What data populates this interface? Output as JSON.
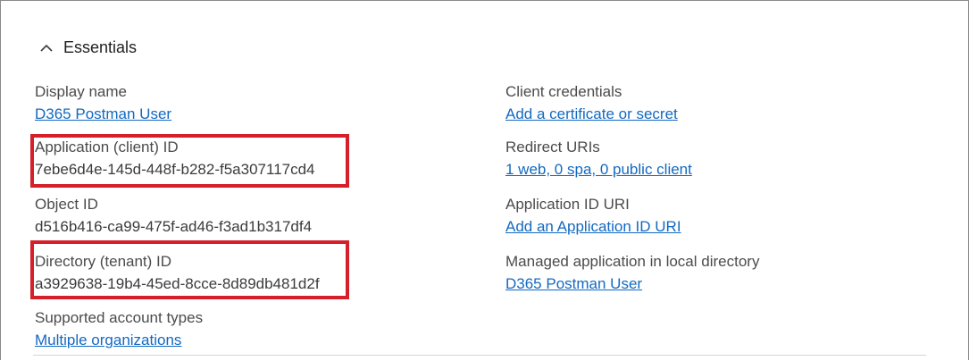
{
  "essentials": {
    "title": "Essentials",
    "chevron_icon": "chevron-up-icon"
  },
  "left_column": [
    {
      "label": "Display name",
      "value": "D365 Postman User",
      "is_link": true
    },
    {
      "label": "Application (client) ID",
      "value": "7ebe6d4e-145d-448f-b282-f5a307117cd4",
      "is_link": false
    },
    {
      "label": "Object ID",
      "value": "d516b416-ca99-475f-ad46-f3ad1b317df4",
      "is_link": false
    },
    {
      "label": "Directory (tenant) ID",
      "value": "a3929638-19b4-45ed-8cce-8d89db481d2f",
      "is_link": false
    },
    {
      "label": "Supported account types",
      "value": "Multiple organizations",
      "is_link": true
    }
  ],
  "right_column": [
    {
      "label": "Client credentials",
      "value": "Add a certificate or secret",
      "is_link": true
    },
    {
      "label": "Redirect URIs",
      "value": "1 web, 0 spa, 0 public client",
      "is_link": true
    },
    {
      "label": "Application ID URI",
      "value": "Add an Application ID URI",
      "is_link": true
    },
    {
      "label": "Managed application in local directory",
      "value": "D365 Postman User",
      "is_link": true
    }
  ],
  "colors": {
    "link": "#1369c1",
    "highlight": "#d51f2a",
    "label": "#4b4b4b"
  }
}
